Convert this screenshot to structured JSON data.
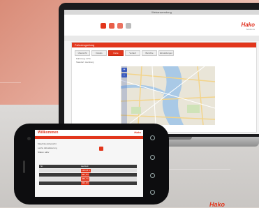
{
  "laptop": {
    "window_title": "Webanwendung",
    "brand_logo": "Hako",
    "brand_sub": "Solutions",
    "panel_title": "Fahrzeugortung",
    "tabs": [
      "Übersicht",
      "Details",
      "Karte",
      "Verlauf",
      "Berichte",
      "Einstellungen"
    ],
    "active_tab_index": 2,
    "info_lines": [
      "Fahrzeug: 4711",
      "Standort: Hamburg"
    ],
    "map_marker_label": "3",
    "accent_color": "#e2361c"
  },
  "phone": {
    "title": "Willkommen",
    "brand_logo": "Hako",
    "info_lines": [
      "Maschinenübersicht",
      "Letzte Aktualisierung",
      "Status: aktiv"
    ],
    "table_rows": [
      {
        "label": "Nr.",
        "value": "Laufzeit"
      },
      {
        "label": "",
        "value": "1234,5 h"
      },
      {
        "label": "",
        "value": "987,6 h"
      },
      {
        "label": "",
        "value": "456,7 h"
      },
      {
        "label": "",
        "value": "321,0 h"
      }
    ]
  },
  "corner_brand": "Hako"
}
